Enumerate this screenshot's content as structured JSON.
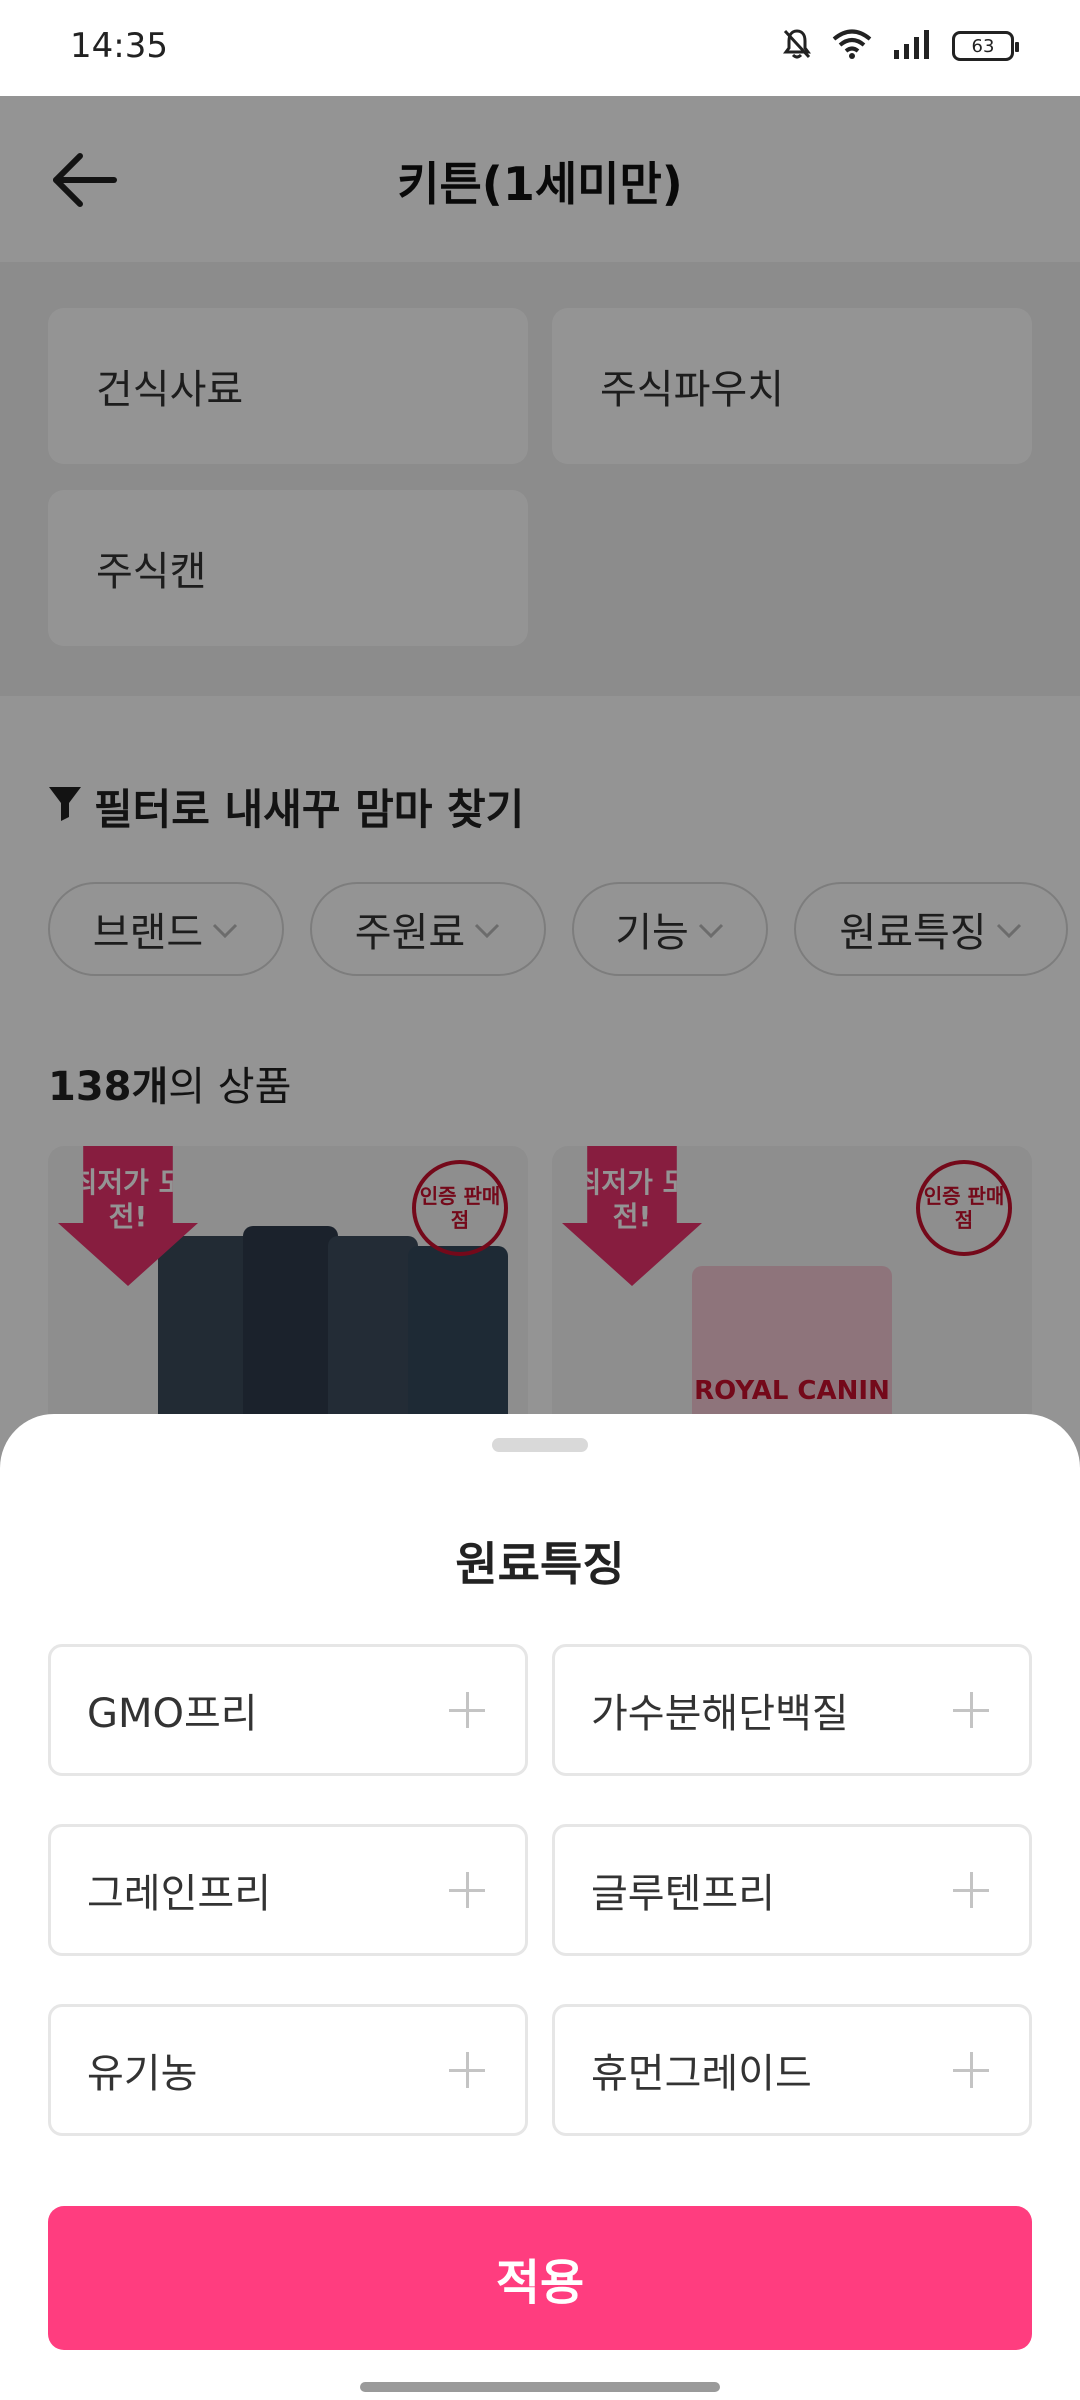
{
  "status_bar": {
    "time": "14:35",
    "battery": "63",
    "icons": [
      "bell-off-icon",
      "wifi-icon",
      "signal-icon",
      "battery-icon"
    ]
  },
  "header": {
    "title": "키튼(1세미만)",
    "back_icon": "arrow-left-icon"
  },
  "categories": [
    {
      "label": "건식사료"
    },
    {
      "label": "주식파우치"
    },
    {
      "label": "주식캔"
    }
  ],
  "filter": {
    "title": "필터로 내새꾸 맘마 찾기",
    "icon": "funnel-icon",
    "chips": [
      {
        "label": "브랜드"
      },
      {
        "label": "주원료"
      },
      {
        "label": "기능"
      },
      {
        "label": "원료특징"
      }
    ]
  },
  "product_count": {
    "number": "138개",
    "suffix": "의 상품"
  },
  "products": [
    {
      "badge": "최저가 도전!",
      "seal": "인증 판매점"
    },
    {
      "badge": "최저가 도전!",
      "seal": "인증 판매점",
      "brand": "ROYAL CANIN"
    }
  ],
  "sheet": {
    "title": "원료특징",
    "options": [
      {
        "label": "GMO프리"
      },
      {
        "label": "가수분해단백질"
      },
      {
        "label": "그레인프리"
      },
      {
        "label": "글루텐프리"
      },
      {
        "label": "유기농"
      },
      {
        "label": "휴먼그레이드"
      }
    ],
    "apply_label": "적용"
  },
  "colors": {
    "accent": "#ff3d7f",
    "badge": "#e8336d",
    "brand_red": "#c8102e"
  }
}
